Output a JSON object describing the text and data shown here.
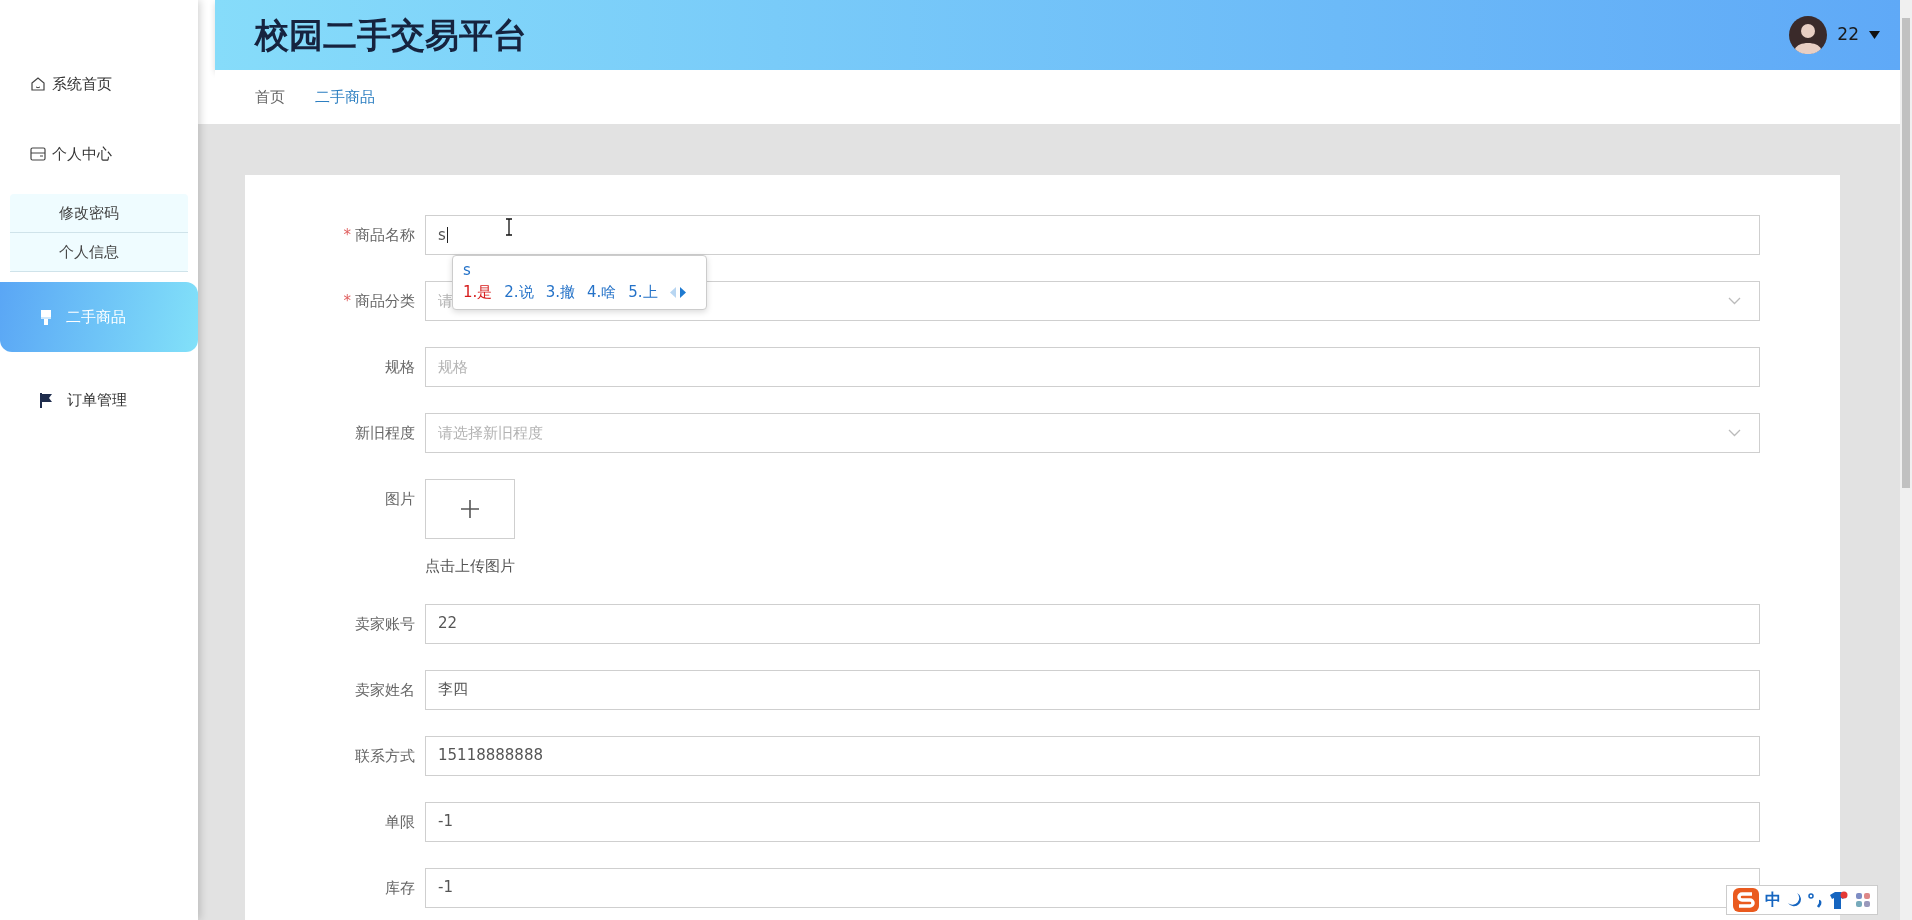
{
  "sidebar": {
    "items": [
      {
        "label": "系统首页",
        "selected": false
      },
      {
        "label": "个人中心",
        "selected": false,
        "expanded": true,
        "children": [
          {
            "label": "修改密码"
          },
          {
            "label": "个人信息"
          }
        ]
      },
      {
        "label": "二手商品",
        "selected": true
      },
      {
        "label": "订单管理",
        "selected": false
      }
    ]
  },
  "header": {
    "title": "校园二手交易平台",
    "user": {
      "name": "22"
    }
  },
  "breadcrumb": [
    {
      "label": "首页",
      "selected": false
    },
    {
      "label": "二手商品",
      "selected": true
    }
  ],
  "form": {
    "required_marker": "*",
    "fields": [
      {
        "label": "商品名称",
        "required": true,
        "kind": "text",
        "value": "s"
      },
      {
        "label": "商品分类",
        "required": true,
        "kind": "select",
        "placeholder": "请"
      },
      {
        "label": "规格",
        "required": false,
        "kind": "text",
        "placeholder": "规格"
      },
      {
        "label": "新旧程度",
        "required": false,
        "kind": "select",
        "placeholder": "请选择新旧程度"
      },
      {
        "label": "图片",
        "required": false,
        "kind": "upload",
        "hint": "点击上传图片"
      },
      {
        "label": "卖家账号",
        "required": false,
        "kind": "text",
        "value": "22"
      },
      {
        "label": "卖家姓名",
        "required": false,
        "kind": "text",
        "value": "李四"
      },
      {
        "label": "联系方式",
        "required": false,
        "kind": "text",
        "value": "15118888888"
      },
      {
        "label": "单限",
        "required": false,
        "kind": "text",
        "value": "-1"
      },
      {
        "label": "库存",
        "required": false,
        "kind": "text",
        "value": "-1"
      }
    ]
  },
  "ime_popup": {
    "composition": "s",
    "candidates": [
      {
        "label": "1.是",
        "selected": true
      },
      {
        "label": "2.说",
        "selected": false
      },
      {
        "label": "3.撤",
        "selected": false
      },
      {
        "label": "4.啥",
        "selected": false
      },
      {
        "label": "5.上",
        "selected": false
      }
    ]
  },
  "ime_toolbar": {
    "mode": "中"
  }
}
